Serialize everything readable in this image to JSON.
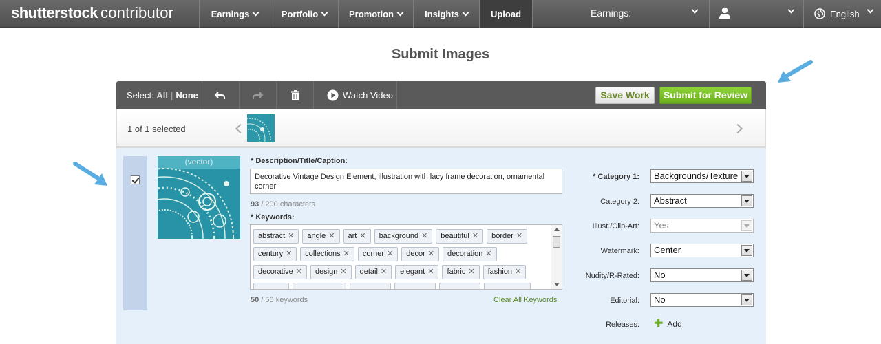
{
  "brand": {
    "name_bold": "shutterstock",
    "name_light": "contributor"
  },
  "nav": {
    "items": [
      {
        "label": "Earnings"
      },
      {
        "label": "Portfolio"
      },
      {
        "label": "Promotion"
      },
      {
        "label": "Insights"
      },
      {
        "label": "Upload"
      }
    ],
    "earnings_dropdown": "Earnings:",
    "language": "English"
  },
  "page": {
    "title": "Submit Images"
  },
  "toolbar": {
    "select_label": "Select:",
    "select_all": "All",
    "select_none": "None",
    "watch_video": "Watch Video",
    "save_work": "Save Work",
    "submit_review": "Submit for Review"
  },
  "strip": {
    "selected_count": "1 of 1 selected"
  },
  "item": {
    "preview_caption": "(vector)",
    "checked": true,
    "description_label": "* Description/Title/Caption:",
    "description_value": "Decorative Vintage Design Element, illustration with lacy frame decoration, ornamental corner",
    "char_count": "93",
    "char_limit": "/ 200 characters",
    "keywords_label": "* Keywords:",
    "keywords": [
      [
        "abstract",
        "angle",
        "art",
        "background",
        "beautiful",
        "border"
      ],
      [
        "century",
        "collections",
        "corner",
        "decor",
        "decoration"
      ],
      [
        "decorative",
        "design",
        "detail",
        "elegant",
        "fabric",
        "fashion"
      ]
    ],
    "keyword_count": "50",
    "keyword_limit": "/ 50 keywords",
    "clear_keywords": "Clear All Keywords"
  },
  "fields": {
    "category1": {
      "label": "* Category 1:",
      "value": "Backgrounds/Texture"
    },
    "category2": {
      "label": "Category 2:",
      "value": "Abstract"
    },
    "illustration": {
      "label": "Illust./Clip-Art:",
      "value": "Yes"
    },
    "watermark": {
      "label": "Watermark:",
      "value": "Center"
    },
    "nudity": {
      "label": "Nudity/R-Rated:",
      "value": "No"
    },
    "editorial": {
      "label": "Editorial:",
      "value": "No"
    },
    "releases": {
      "label": "Releases:",
      "add": "Add"
    }
  },
  "colors": {
    "accent_green": "#6aae20",
    "annotation_blue": "#5aade0",
    "item_bg": "#e6f0fa"
  }
}
